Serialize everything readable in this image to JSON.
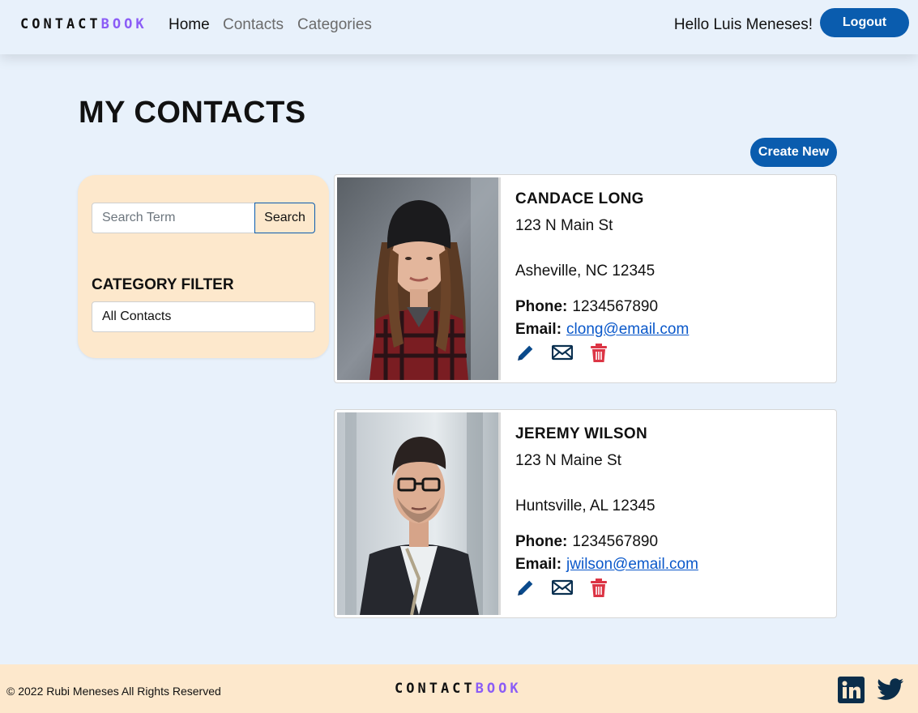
{
  "brand": {
    "part1": "CONTACT",
    "part2": "BOOK"
  },
  "nav": {
    "home": "Home",
    "contacts": "Contacts",
    "categories": "Categories"
  },
  "header": {
    "greeting": "Hello Luis Meneses!",
    "logout": "Logout"
  },
  "page": {
    "title": "MY CONTACTS",
    "create_new": "Create New"
  },
  "sidebar": {
    "search_placeholder": "Search Term",
    "search_value": "",
    "search_button": "Search",
    "filter_title": "CATEGORY FILTER",
    "filter_selected": "All Contacts"
  },
  "contacts": [
    {
      "name": "CANDACE LONG",
      "address1": "123 N Main St",
      "address2": "Asheville, NC 12345",
      "phone_label": "Phone:",
      "phone": "1234567890",
      "email_label": "Email:",
      "email": "clong@email.com"
    },
    {
      "name": "JEREMY WILSON",
      "address1": "123 N Maine St",
      "address2": "Huntsville, AL 12345",
      "phone_label": "Phone:",
      "phone": "1234567890",
      "email_label": "Email:",
      "email": "jwilson@email.com"
    }
  ],
  "icons": {
    "edit": "pencil-icon",
    "email": "envelope-icon",
    "delete": "trash-icon",
    "linkedin": "linkedin-icon",
    "twitter": "twitter-icon"
  },
  "colors": {
    "primary": "#0a5cae",
    "accent": "#8b5cf6",
    "danger": "#dc3545",
    "panel": "#fde8cc",
    "background": "#e8f1fb"
  },
  "footer": {
    "copyright": "© 2022 Rubi Meneses All Rights Reserved"
  }
}
